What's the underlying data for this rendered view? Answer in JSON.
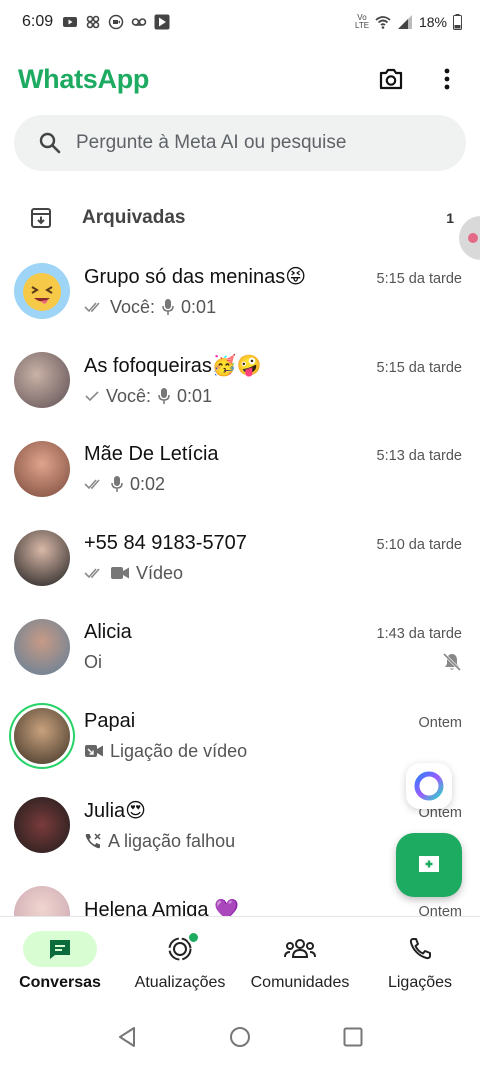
{
  "status_bar": {
    "time": "6:09",
    "network": "Vo LTE",
    "battery": "18%"
  },
  "header": {
    "title": "WhatsApp"
  },
  "search": {
    "placeholder": "Pergunte à Meta AI ou pesquise"
  },
  "archived": {
    "label": "Arquivadas",
    "count": "1"
  },
  "chats": [
    {
      "name": "Grupo só das meninas😝",
      "time": "5:15 da tarde",
      "sender": "Você:",
      "tick": "double",
      "icon": "mic-icon",
      "preview": "0:01",
      "avatar_color": "#9ed4f5"
    },
    {
      "name": "As fofoqueiras🥳🤪",
      "time": "5:15 da tarde",
      "sender": "Você:",
      "tick": "single",
      "icon": "mic-icon",
      "preview": "0:01",
      "avatar_color": "#7d6b6b"
    },
    {
      "name": "Mãe De Letícia",
      "time": "5:13 da tarde",
      "sender": "",
      "tick": "double",
      "icon": "mic-icon",
      "preview": "0:02",
      "avatar_color": "#b97b6a"
    },
    {
      "name": "+55 84 9183-5707",
      "time": "5:10 da tarde",
      "sender": "",
      "tick": "double",
      "icon": "video-icon",
      "preview": "Vídeo",
      "avatar_color": "#3b3b3b"
    },
    {
      "name": "Alicia",
      "time": "1:43 da tarde",
      "sender": "",
      "tick": "none",
      "icon": "",
      "preview": "Oi",
      "avatar_color": "#7aa9c9",
      "muted": true
    },
    {
      "name": "Papai",
      "time": "Ontem",
      "sender": "",
      "tick": "none",
      "icon": "video-call-icon",
      "preview": "Ligação de vídeo",
      "avatar_color": "#6b5a44",
      "status_ring": true
    },
    {
      "name": "Julia😍",
      "time": "Ontem",
      "sender": "",
      "tick": "none",
      "icon": "missed-call-icon",
      "preview": "A ligação falhou",
      "avatar_color": "#2e2b2b"
    },
    {
      "name": "Helena Amiga 💜",
      "time": "Ontem",
      "sender": "",
      "tick": "none",
      "icon": "",
      "preview": "",
      "avatar_color": "#e9d6dc"
    }
  ],
  "bottom_nav": [
    {
      "label": "Conversas",
      "icon": "chats-icon",
      "active": true
    },
    {
      "label": "Atualizações",
      "icon": "updates-icon",
      "active": false
    },
    {
      "label": "Comunidades",
      "icon": "communities-icon",
      "active": false
    },
    {
      "label": "Ligações",
      "icon": "calls-icon",
      "active": false
    }
  ],
  "colors": {
    "brand": "#1daa61",
    "active_tab_bg": "#d8fdd2"
  }
}
